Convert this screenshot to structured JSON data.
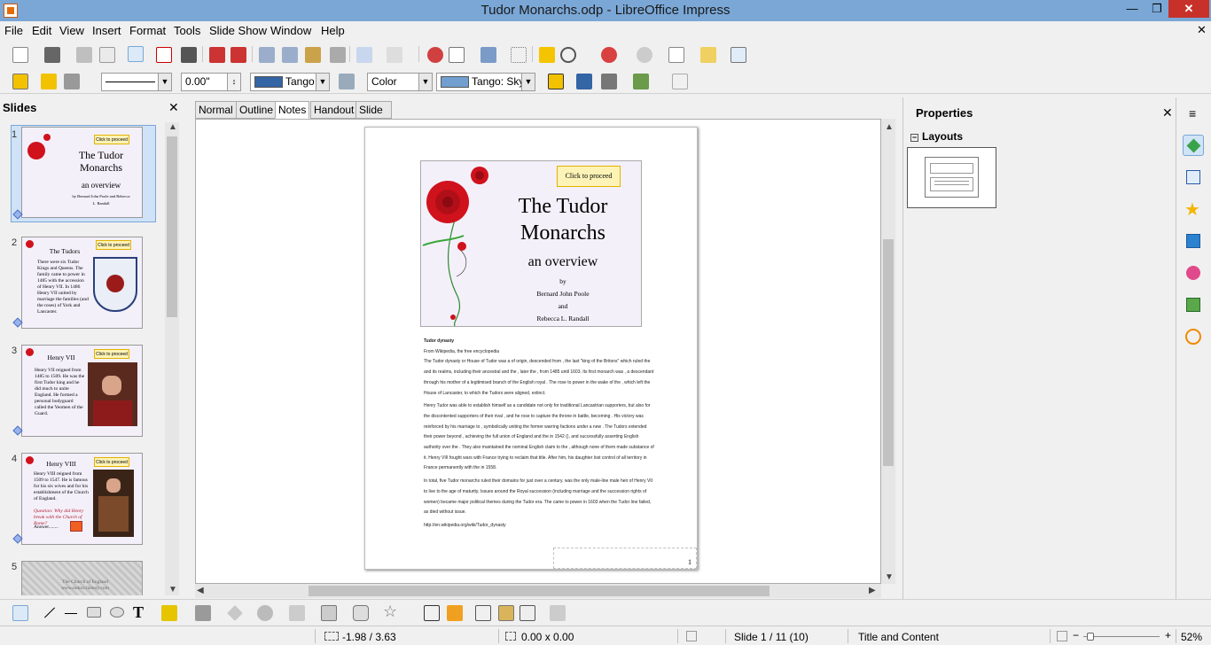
{
  "window": {
    "title": "Tudor Monarchs.odp - LibreOffice Impress",
    "min": "—",
    "max": "❐",
    "close": "✕"
  },
  "menu": [
    "File",
    "Edit",
    "View",
    "Insert",
    "Format",
    "Tools",
    "Slide Show",
    "Window",
    "Help"
  ],
  "menu_close": "✕",
  "toolbar2": {
    "line_width": "0.00\"",
    "line_color": "Tango",
    "area_style": "Color",
    "area_color": "Tango: Sky",
    "accent_line": "#3465a4",
    "accent_sky": "#729fcf"
  },
  "slides_panel": {
    "title": "Slides",
    "close": "✕",
    "slides": [
      {
        "num": "1",
        "title": "The Tudor Monarchs",
        "subtitle": "an overview",
        "byline": "by Bernard John Poole and Rebecca L. Randall",
        "button": "Click to proceed"
      },
      {
        "num": "2",
        "title": "The Tudors",
        "button": "Click to proceed",
        "body": "There were six Tudor Kings and Queens. The family came to power in 1485 with the accession of Henry VII. In 1486 Henry VII united by marriage the families (and the roses) of York and Lancaster."
      },
      {
        "num": "3",
        "title": "Henry VII",
        "button": "Click to proceed",
        "body": "Henry VII reigned from 1485 to 1509. He was the first Tudor king and he did much to unite England. He formed a personal bodyguard called the Yeomen of the Guard."
      },
      {
        "num": "4",
        "title": "Henry VIII",
        "button": "Click to proceed",
        "body": "Henry VIII reigned from 1509 to 1547. He is famous for his six wives and for his establishment of the Church of England.",
        "question": "Question: Why did Henry break with the Church of Rome?",
        "answer": "Answer........"
      },
      {
        "num": "5",
        "body": "The Church of England www.tudors.history.com"
      }
    ]
  },
  "view_tabs": [
    "Normal",
    "Outline",
    "Notes",
    "Handout",
    "Slide Sorter"
  ],
  "active_tab": "Notes",
  "notes_page": {
    "slide": {
      "button": "Click to proceed",
      "title_line1": "The Tudor",
      "title_line2": "Monarchs",
      "subtitle": "an overview",
      "by": "by",
      "author1": "Bernard John Poole",
      "and": "and",
      "author2": "Rebecca L. Randall"
    },
    "notes": [
      "Tudor dynasty",
      "From Wikipedia, the free encyclopedia",
      "The Tudor dynasty or House of Tudor was a of origin, descended from , the last \"king of the Britons\" which ruled the and its realms, including their ancestral and the , later the , from 1485 until 1603. Its first monarch was , a descendant through his mother of a legitimised branch of the English royal . The rose to power in the wake of the , which left the House of Lancaster, to which the Tudors were aligned, extinct.",
      "Henry Tudor was able to establish himself as a candidate not only for traditional Lancastrian supporters, but also for the discontented supporters of their rival , and he rose to capture the throne in battle, becoming . His victory was reinforced by his marriage to , symbolically uniting the former warring factions under a new . The Tudors extended their power beyond , achieving the full union of England and the in 1542 (), and successfully asserting English authority over the . They also maintained the nominal English claim to the , although none of them made substance of it. Henry VIII fought wars with France trying to reclaim that title. After him, his daughter lost control of all territory in France permanently with the in 1558.",
      "In total, five Tudor monarchs ruled their domains for just over a century. was the only male-line male heir of Henry VII to live to the age of maturity. Issues around the Royal succession (including marriage and the succession rights of women) became major political themes during the Tudor era. The came to power in 1603 when the Tudor line failed, as died without issue.",
      "http://en.wikipedia.org/wiki/Tudor_dynasty"
    ],
    "page_number": "1"
  },
  "properties": {
    "title": "Properties",
    "close": "✕",
    "section": "Layouts",
    "toggle": "−",
    "menu_icon": "≡"
  },
  "status": {
    "position": "-1.98 / 3.63",
    "size": "0.00 x 0.00",
    "slide": "Slide 1 / 11 (10)",
    "layout": "Title and Content",
    "zoom": "52%",
    "zoom_minus": "−",
    "zoom_plus": "+"
  }
}
